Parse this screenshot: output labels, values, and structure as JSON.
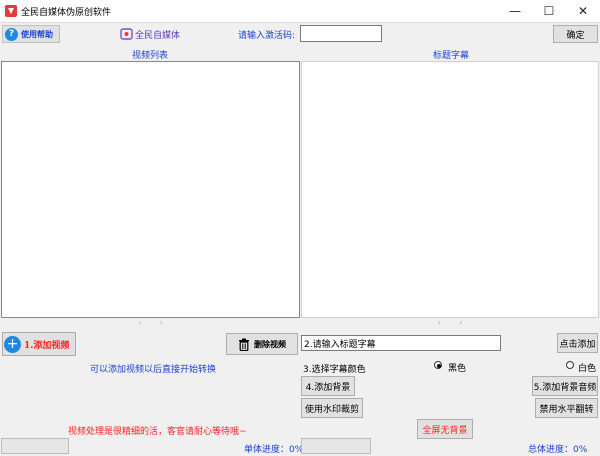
{
  "window": {
    "title": "全民自媒体伪原创软件",
    "minimize": "—",
    "maximize": "☐",
    "close": "✕"
  },
  "toolbar": {
    "help_label": "使用帮助",
    "brand_label": "全民自媒体",
    "activation_label": "请输入激活码:",
    "activation_value": "",
    "confirm_label": "确定"
  },
  "video_list": {
    "header": "视频列表",
    "scroll_left": "‹",
    "scroll_right": "›"
  },
  "subtitle_panel": {
    "header": "标题字幕",
    "scroll_left": "‹",
    "scroll_right": "›"
  },
  "actions": {
    "add_video": "1.添加视频",
    "delete_video": "删除视频",
    "hint": "可以添加视频以后直接开始转换",
    "patience_note": "视频处理是很精细的活，客官请耐心等待哦~",
    "single_progress": "单体进度：0%"
  },
  "subtitle_options": {
    "title_input_value": "2.请输入标题字幕",
    "click_add": "点击添加",
    "color_label": "3.选择字幕颜色",
    "color_black": "黑色",
    "color_white": "白色",
    "add_background": "4.添加背景",
    "watermark_crop": "使用水印裁剪",
    "add_bg_audio": "5.添加背景音频",
    "disable_hflip": "禁用水平翻转",
    "fullscreen_no_bg": "全屏无背景",
    "total_progress": "总体进度：0%"
  },
  "selected_color": "黑色",
  "colors": {
    "accent_blue": "#1a3fd6",
    "warn_red": "#ff2020",
    "help_icon": "#1e88e5"
  }
}
